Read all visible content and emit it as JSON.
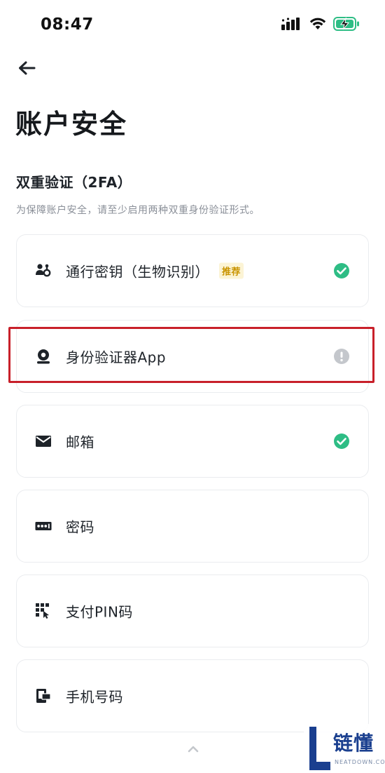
{
  "status_bar": {
    "time": "08:47",
    "icons": [
      "cellular-signal-icon",
      "wifi-icon",
      "battery-charging-icon"
    ]
  },
  "header": {
    "back_icon": "arrow-left-icon",
    "title": "账户安全"
  },
  "section": {
    "title": "双重验证（2FA）",
    "description": "为保障账户安全，请至少启用两种双重身份验证形式。"
  },
  "items": [
    {
      "label": "通行密钥（生物识别）",
      "badge": "推荐",
      "icon": "passkey-icon",
      "status": "enabled"
    },
    {
      "label": "身份验证器App",
      "badge": "",
      "icon": "authenticator-icon",
      "status": "warning"
    },
    {
      "label": "邮箱",
      "badge": "",
      "icon": "mail-icon",
      "status": "enabled"
    },
    {
      "label": "密码",
      "badge": "",
      "icon": "password-icon",
      "status": "none"
    },
    {
      "label": "支付PIN码",
      "badge": "",
      "icon": "pin-keypad-icon",
      "status": "none"
    },
    {
      "label": "手机号码",
      "badge": "",
      "icon": "phone-icon",
      "status": "none"
    }
  ],
  "colors": {
    "enabled": "#2ebd85",
    "warning": "#c4c7cc",
    "badge_text": "#c99400",
    "badge_bg": "#fcf4d5",
    "highlight": "#c8202a",
    "watermark": "#1a3f8f"
  },
  "watermark": {
    "text": "链懂",
    "sub": "NEATDOWN.COM"
  }
}
